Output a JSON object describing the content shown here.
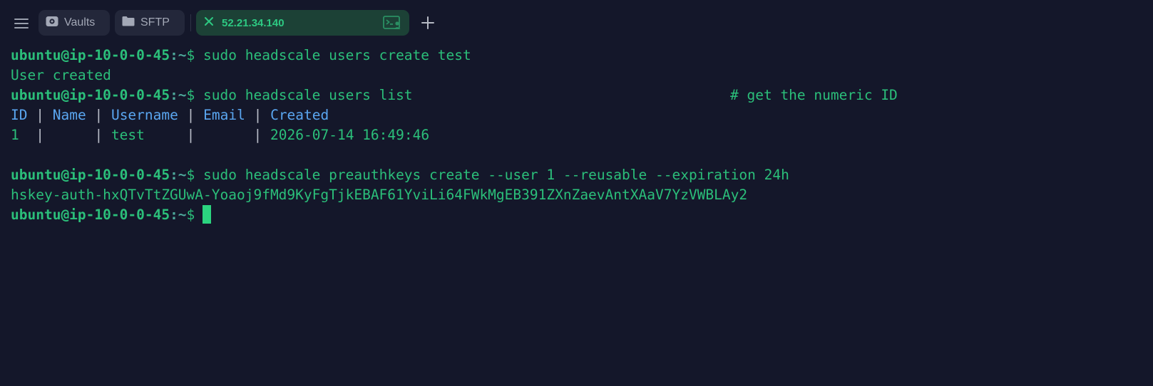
{
  "tabbar": {
    "tabs": [
      {
        "label": "Vaults",
        "icon": "vault-icon"
      },
      {
        "label": "SFTP",
        "icon": "folder-icon"
      },
      {
        "label": "52.21.34.140",
        "icon": "close-icon",
        "active": true
      }
    ]
  },
  "terminal": {
    "prompt_user": "ubuntu@ip-10-0-0-45",
    "prompt_path": ":~",
    "prompt_symbol": "$",
    "commands": [
      "sudo headscale users create test",
      "sudo headscale users list",
      "sudo headscale preauthkeys create --user 1 --reusable --expiration 24h"
    ],
    "comment": "# get the numeric ID",
    "output_user_created": "User created",
    "table": {
      "headers": [
        "ID",
        "Name",
        "Username",
        "Email",
        "Created"
      ],
      "row": [
        "1",
        "",
        "test",
        "",
        "2026-07-14 16:49:46"
      ]
    },
    "preauth_key": "hskey-auth-hxQTvTtZGUwA-Yoaoj9fMd9KyFgTjkEBAF61YviLi64FWkMgEB391ZXnZaevAntXAaV7YzVWBLAy2"
  },
  "colors": {
    "background": "#14172a",
    "accent": "#2bbf7a",
    "header_blue": "#5aa6f0",
    "active_tab_bg": "#1c4136"
  }
}
